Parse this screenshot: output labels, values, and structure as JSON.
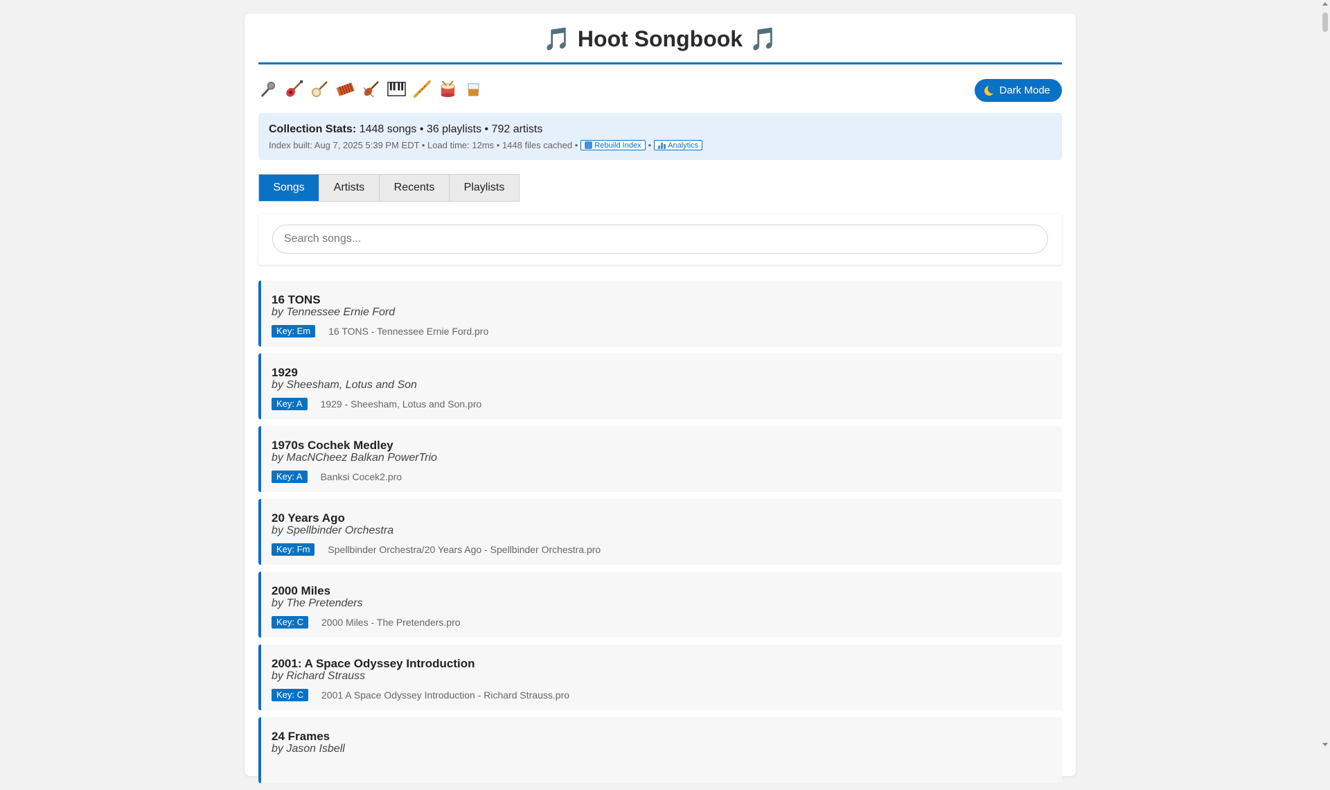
{
  "header": {
    "title": "Hoot Songbook",
    "note_glyph": "🎵"
  },
  "instruments": [
    {
      "name": "microphone-icon"
    },
    {
      "name": "electric-guitar-icon"
    },
    {
      "name": "banjo-icon"
    },
    {
      "name": "accordion-icon"
    },
    {
      "name": "fiddle-icon"
    },
    {
      "name": "piano-keys-icon"
    },
    {
      "name": "flute-icon"
    },
    {
      "name": "drum-icon"
    },
    {
      "name": "whiskey-glass-icon"
    }
  ],
  "dark_mode": {
    "label": "Dark Mode",
    "icon": "moon-icon"
  },
  "stats": {
    "label": "Collection Stats:",
    "summary": "1448 songs • 36 playlists • 792 artists",
    "index_info": "Index built: Aug 7, 2025 5:39 PM EDT • Load time: 12ms • 1448 files cached •",
    "rebuild_label": "Rebuild Index",
    "separator": "•",
    "analytics_label": "Analytics"
  },
  "tabs": [
    {
      "label": "Songs",
      "active": true
    },
    {
      "label": "Artists",
      "active": false
    },
    {
      "label": "Recents",
      "active": false
    },
    {
      "label": "Playlists",
      "active": false
    }
  ],
  "search": {
    "placeholder": "Search songs...",
    "value": ""
  },
  "songs": [
    {
      "title": "16 TONS",
      "artist": "by Tennessee Ernie Ford",
      "key": "Key: Em",
      "file": "16 TONS - Tennessee Ernie Ford.pro"
    },
    {
      "title": "1929",
      "artist": "by Sheesham, Lotus and Son",
      "key": "Key: A",
      "file": "1929 - Sheesham, Lotus and Son.pro"
    },
    {
      "title": "1970s Cochek Medley",
      "artist": "by MacNCheez Balkan PowerTrio",
      "key": "Key: A",
      "file": "Banksi Cocek2.pro"
    },
    {
      "title": "20 Years Ago",
      "artist": "by Spellbinder Orchestra",
      "key": "Key: Fm",
      "file": "Spellbinder Orchestra/20 Years Ago - Spellbinder Orchestra.pro"
    },
    {
      "title": "2000 Miles",
      "artist": "by The Pretenders",
      "key": "Key: C",
      "file": "2000 Miles - The Pretenders.pro"
    },
    {
      "title": "2001: A Space Odyssey Introduction",
      "artist": "by Richard Strauss",
      "key": "Key: C",
      "file": "2001 A Space Odyssey Introduction - Richard Strauss.pro"
    },
    {
      "title": "24 Frames",
      "artist": "by Jason Isbell",
      "key": "",
      "file": ""
    }
  ],
  "colors": {
    "accent": "#0a72c4",
    "stats_bg": "#e5f0fb",
    "card_bg": "#f7f7f7"
  }
}
